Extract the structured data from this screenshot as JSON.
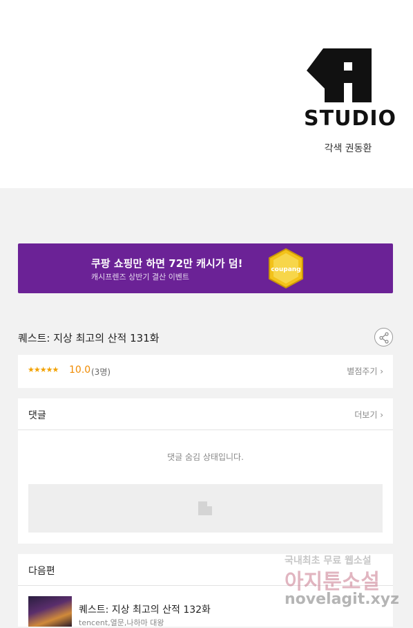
{
  "header": {
    "logo_text": "STUDIO",
    "credit": "각색 권동환"
  },
  "banner": {
    "title": "쿠팡 쇼핑만 하면 72만 캐시가 덤!",
    "subtitle": "캐시프렌즈 상반기 결산 이벤트",
    "badge": "coupang",
    "accent": "#6b2296"
  },
  "episode": {
    "title": "퀘스트: 지상 최고의 산적 131화"
  },
  "rating": {
    "stars": "★★★★★",
    "score": "10.0",
    "count": "(3명)",
    "rate_label": "별점주기 ›"
  },
  "comments": {
    "title": "댓글",
    "more_label": "더보기 ›",
    "hidden_message": "댓글 숨김 상태입니다."
  },
  "next": {
    "title": "다음편",
    "episode_title": "퀘스트: 지상 최고의 산적 132화",
    "meta": "tencent,열문,나하마 대왕"
  },
  "watermark": {
    "line1": "국내최초 무료 웹소설",
    "line2": "아지툰소설",
    "line3": "novelagit.xyz"
  }
}
